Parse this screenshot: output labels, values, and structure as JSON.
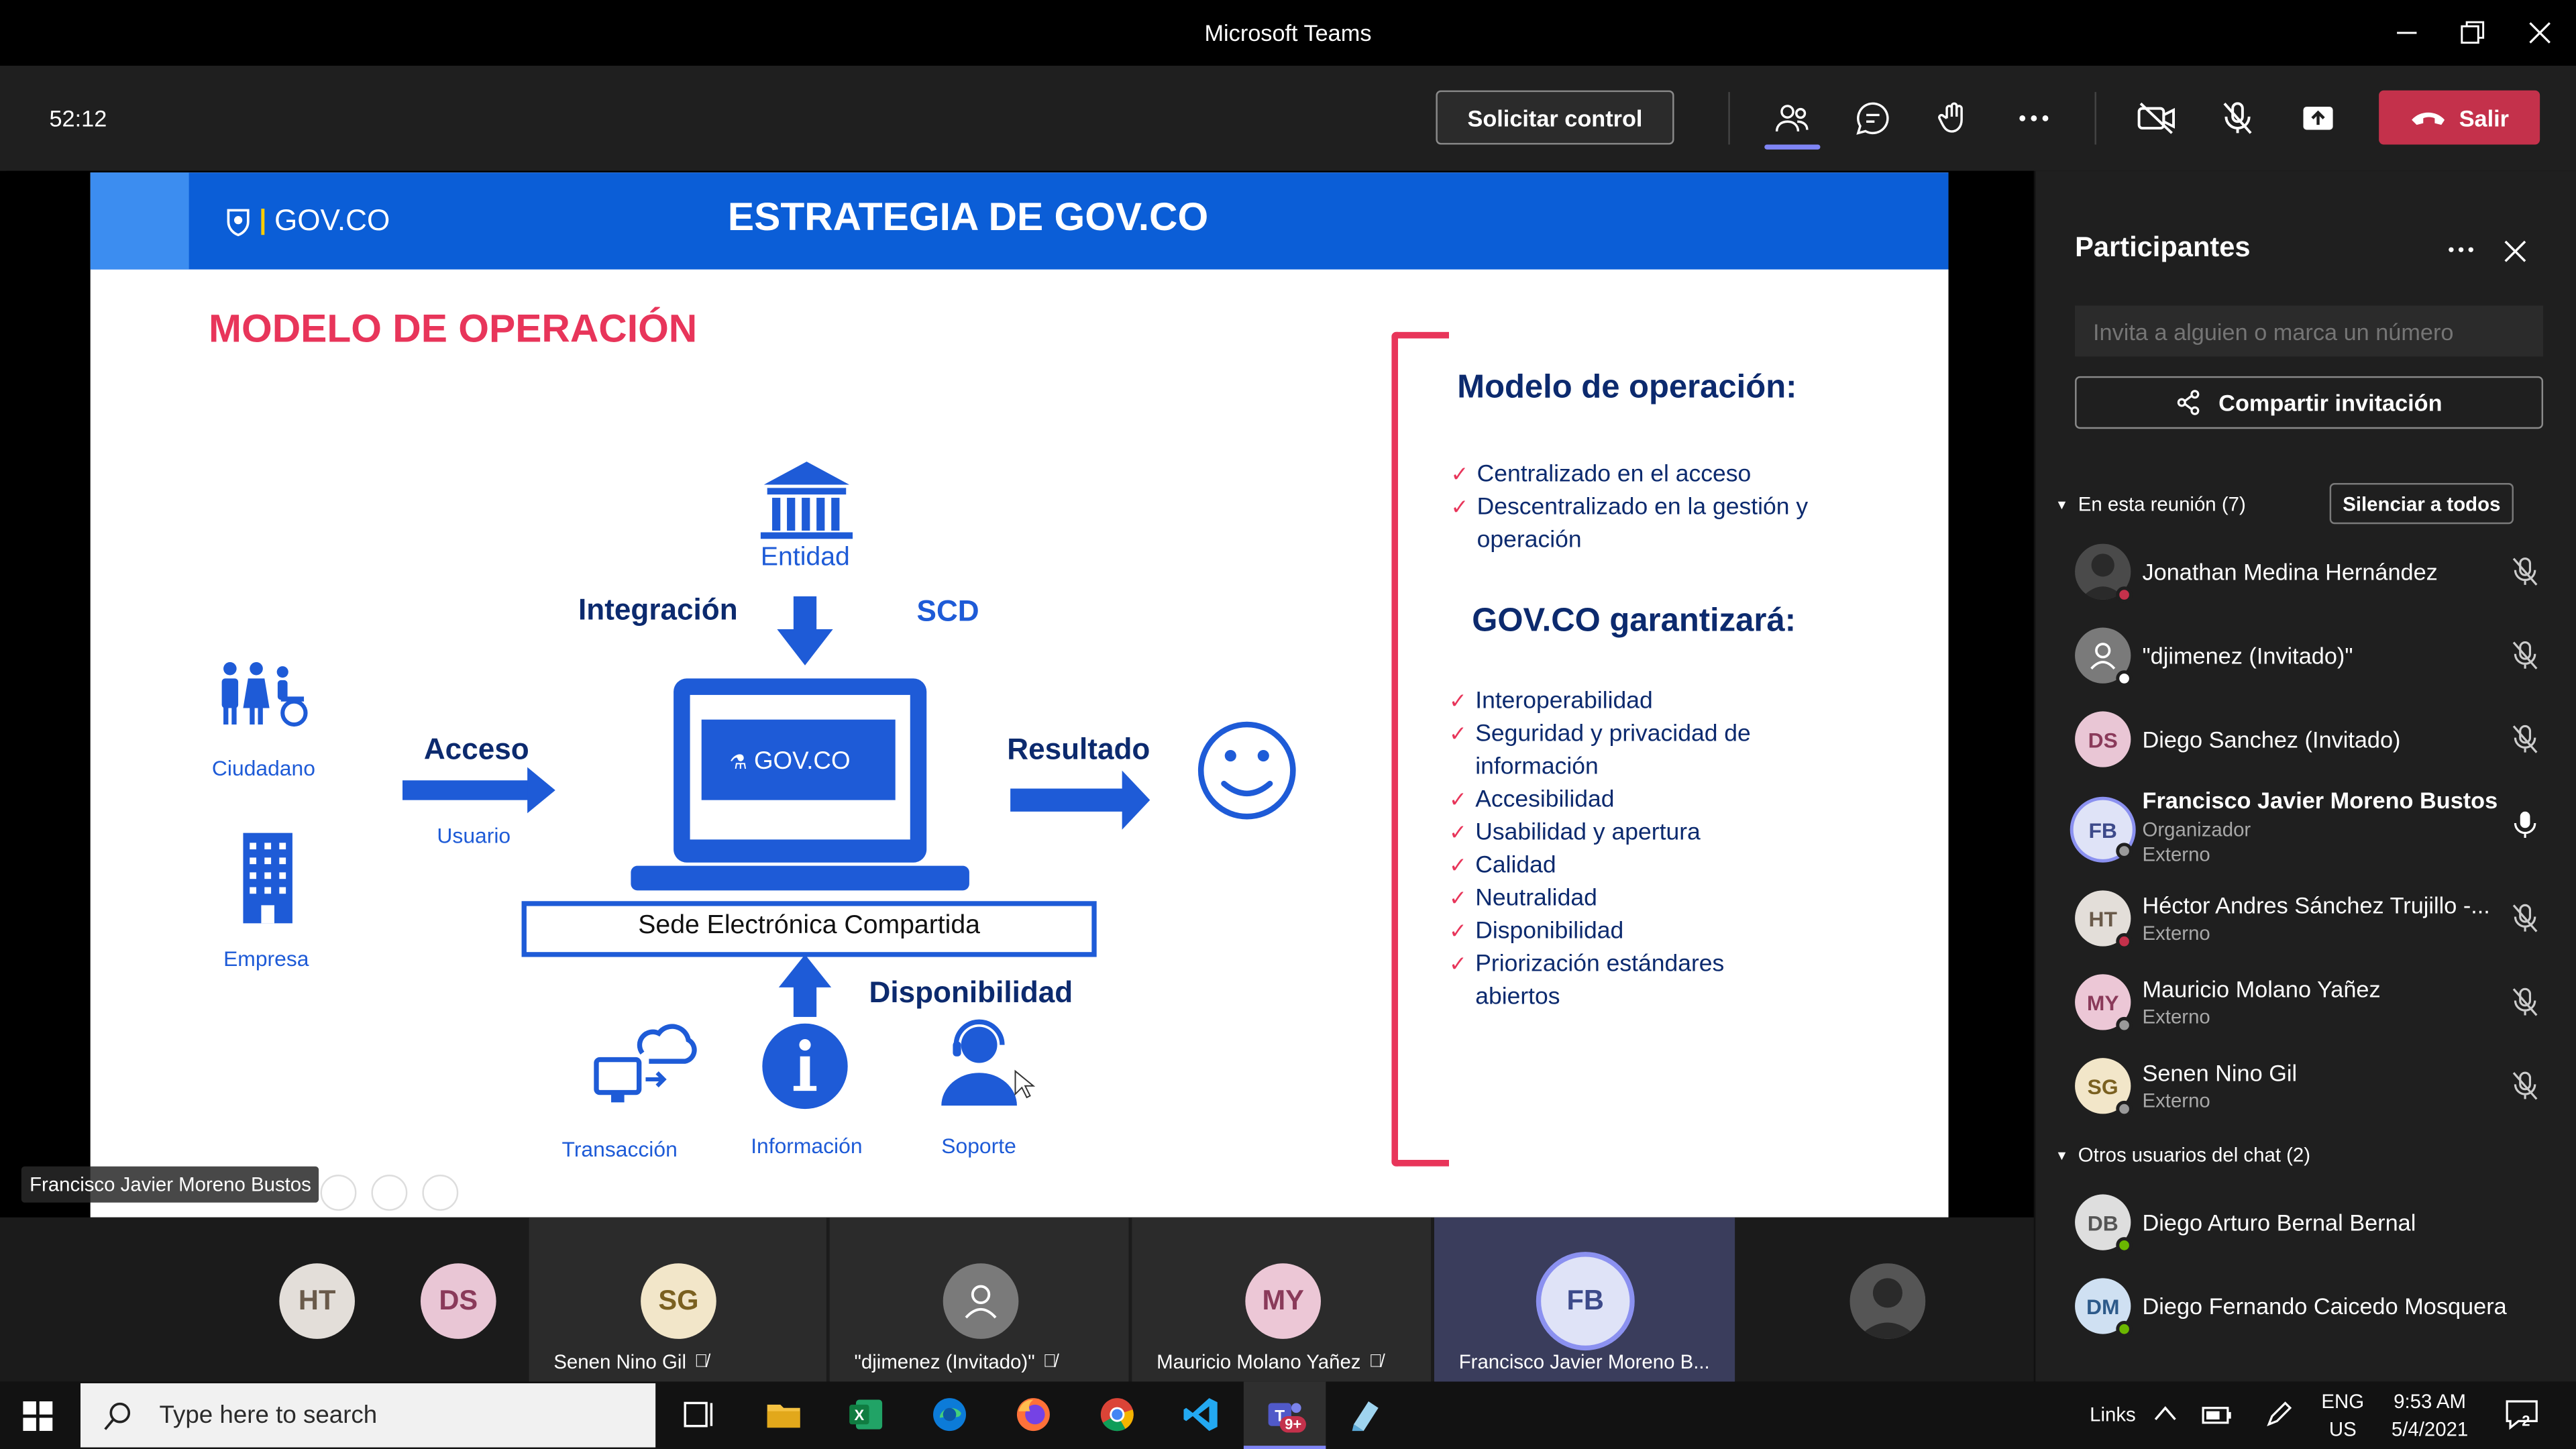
{
  "window": {
    "title": "Microsoft Teams"
  },
  "toolbar": {
    "timer": "52:12",
    "request_control": "Solicitar control",
    "leave": "Salir"
  },
  "slide": {
    "logo": "GOV.CO",
    "title": "ESTRATEGIA DE GOV.CO",
    "subtitle": "MODELO DE OPERACIÓN",
    "entidad": "Entidad",
    "integracion": "Integración",
    "scd": "SCD",
    "ciudadano": "Ciudadano",
    "empresa": "Empresa",
    "acceso": "Acceso",
    "usuario": "Usuario",
    "resultado": "Resultado",
    "laptop_logo": "GOV.CO",
    "sede": "Sede Electrónica Compartida",
    "disponibilidad": "Disponibilidad",
    "transaccion": "Transacción",
    "informacion": "Información",
    "soporte": "Soporte",
    "right_head1": "Modelo de operación:",
    "right_list1": [
      "Centralizado en el acceso",
      "Descentralizado en la gestión y operación"
    ],
    "right_head2": "GOV.CO garantizará:",
    "right_list2": [
      "Interoperabilidad",
      "Seguridad y privacidad de información",
      "Accesibilidad",
      "Usabilidad y  apertura",
      "Calidad",
      "Neutralidad",
      "Disponibilidad",
      "Priorización estándares abiertos"
    ]
  },
  "presenter_tag": "Francisco Javier Moreno Bustos",
  "panel": {
    "title": "Participantes",
    "invite_placeholder": "Invita a alguien o marca un número",
    "share": "Compartir invitación",
    "in_meeting": "En esta reunión (7)",
    "mute_all": "Silenciar a todos",
    "others": "Otros usuarios del chat (2)",
    "participants": [
      {
        "initials": "",
        "name": "Jonathan Medina Hernández",
        "sub": "",
        "sub2": ""
      },
      {
        "initials": "",
        "name": "\"djimenez (Invitado)\"",
        "sub": "",
        "sub2": ""
      },
      {
        "initials": "DS",
        "name": "Diego Sanchez (Invitado)",
        "sub": "",
        "sub2": ""
      },
      {
        "initials": "FB",
        "name": "Francisco Javier Moreno Bustos",
        "sub": "Organizador",
        "sub2": "Externo"
      },
      {
        "initials": "HT",
        "name": "Héctor Andres Sánchez Trujillo -...",
        "sub": "Externo",
        "sub2": ""
      },
      {
        "initials": "MY",
        "name": "Mauricio Molano Yañez",
        "sub": "Externo",
        "sub2": ""
      },
      {
        "initials": "SG",
        "name": "Senen Nino Gil",
        "sub": "Externo",
        "sub2": ""
      }
    ],
    "chat_users": [
      {
        "initials": "DB",
        "name": "Diego Arturo Bernal Bernal"
      },
      {
        "initials": "DM",
        "name": "Diego Fernando Caicedo Mosquera"
      }
    ]
  },
  "strip": {
    "tiles": [
      {
        "initials": "HT",
        "name": ""
      },
      {
        "initials": "DS",
        "name": ""
      },
      {
        "initials": "SG",
        "name": "Senen Nino Gil"
      },
      {
        "initials": "",
        "name": "\"djimenez (Invitado)\""
      },
      {
        "initials": "MY",
        "name": "Mauricio Molano Yañez"
      },
      {
        "initials": "FB",
        "name": "Francisco Javier Moreno B..."
      }
    ]
  },
  "taskbar": {
    "search_placeholder": "Type here to search",
    "links": "Links",
    "lang1": "ENG",
    "lang2": "US",
    "time": "9:53 AM",
    "date": "5/4/2021",
    "notif_count": "2",
    "teams_badge": "9+"
  },
  "colors": {
    "accent": "#0b5ed7",
    "leave": "#c4314b",
    "slide_pink": "#e8355a",
    "slide_navy": "#0c2a6e"
  }
}
